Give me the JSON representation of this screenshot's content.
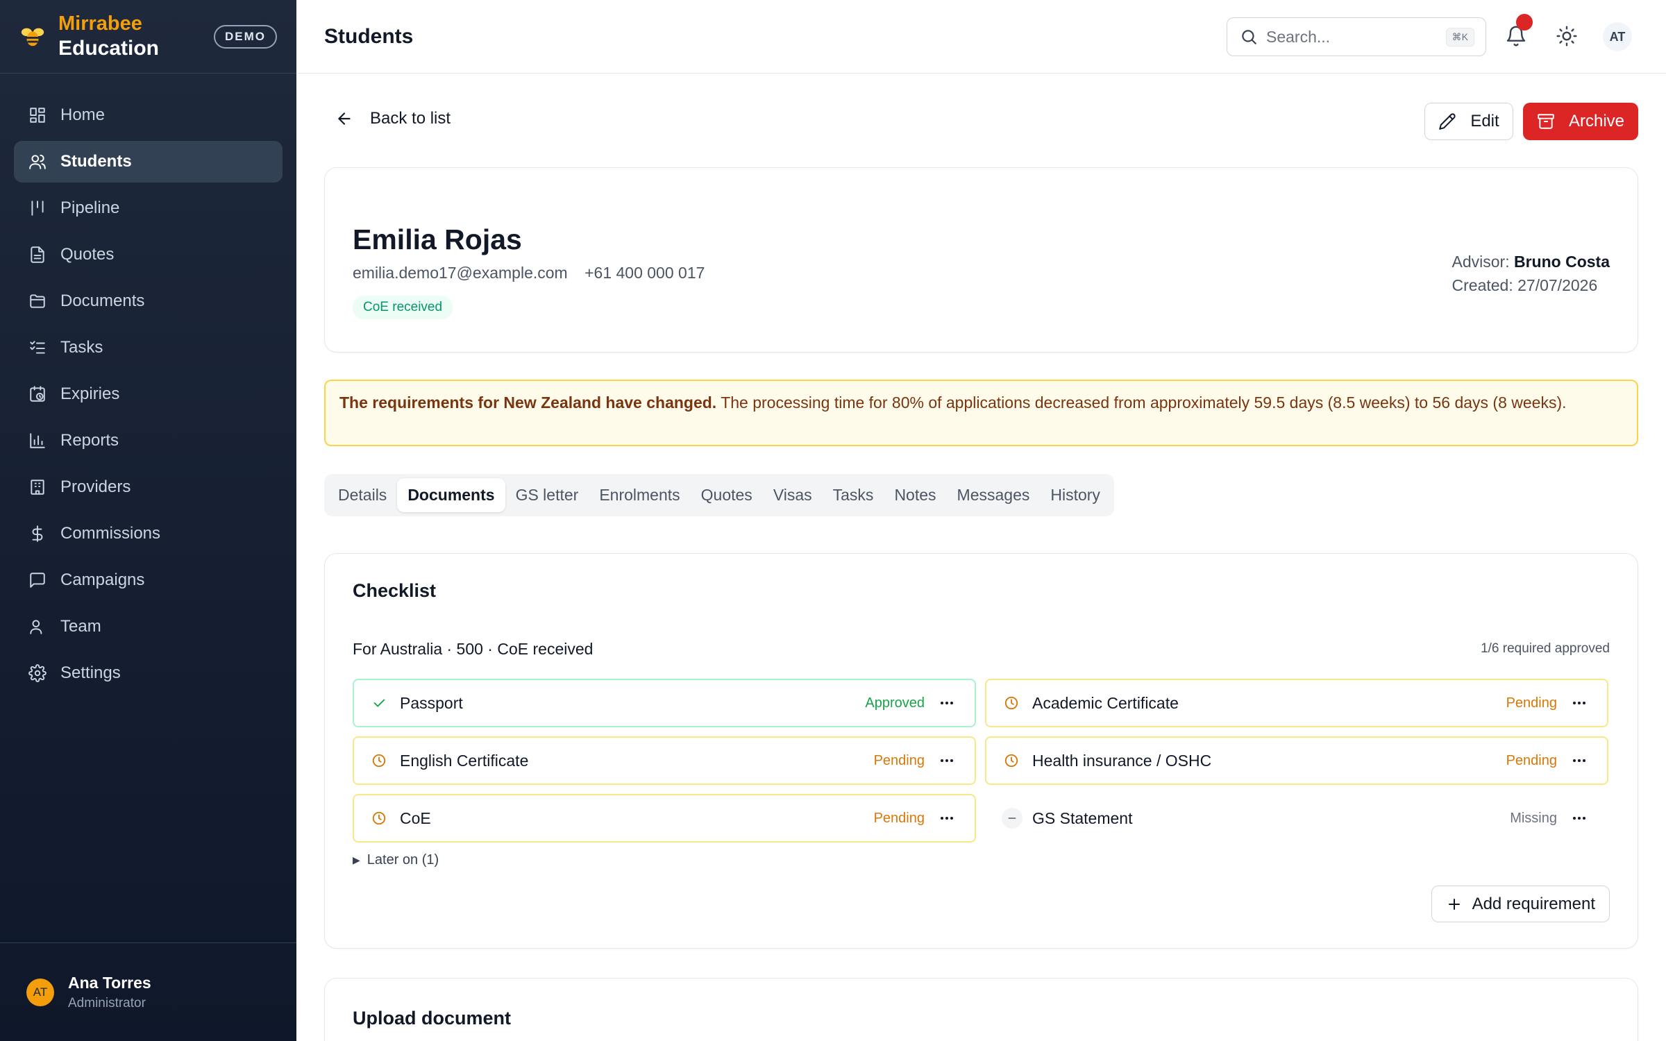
{
  "brand": {
    "name": "Mirrabee",
    "sub": "Education",
    "badge": "DEMO"
  },
  "sidebar": {
    "items": [
      {
        "label": "Home",
        "icon": "grid-icon",
        "active": false
      },
      {
        "label": "Students",
        "icon": "users-icon",
        "active": true
      },
      {
        "label": "Pipeline",
        "icon": "pipeline-icon",
        "active": false
      },
      {
        "label": "Quotes",
        "icon": "document-icon",
        "active": false
      },
      {
        "label": "Documents",
        "icon": "folder-icon",
        "active": false
      },
      {
        "label": "Tasks",
        "icon": "checklist-icon",
        "active": false
      },
      {
        "label": "Expiries",
        "icon": "calendar-clock-icon",
        "active": false
      },
      {
        "label": "Reports",
        "icon": "bar-chart-icon",
        "active": false
      },
      {
        "label": "Providers",
        "icon": "building-icon",
        "active": false
      },
      {
        "label": "Commissions",
        "icon": "dollar-icon",
        "active": false
      },
      {
        "label": "Campaigns",
        "icon": "message-icon",
        "active": false
      },
      {
        "label": "Team",
        "icon": "team-icon",
        "active": false
      },
      {
        "label": "Settings",
        "icon": "gear-icon",
        "active": false
      }
    ],
    "user": {
      "initials": "AT",
      "name": "Ana Torres",
      "role": "Administrator"
    }
  },
  "header": {
    "title": "Students",
    "search_placeholder": "Search...",
    "search_shortcut": "⌘K",
    "avatar_initials": "AT"
  },
  "actions": {
    "back": "Back to list",
    "edit": "Edit",
    "archive": "Archive"
  },
  "student": {
    "name": "Emilia Rojas",
    "email": "emilia.demo17@example.com",
    "phone": "+61 400 000 017",
    "status": "CoE received",
    "advisor_label": "Advisor:",
    "advisor": "Bruno Costa",
    "created_label": "Created:",
    "created": "27/07/2026"
  },
  "alert": {
    "title": "The requirements for New Zealand have changed.",
    "body": "The processing time for 80% of applications decreased from approximately 59.5 days (8.5 weeks) to 56 days (8 weeks)."
  },
  "tabs": [
    "Details",
    "Documents",
    "GS letter",
    "Enrolments",
    "Quotes",
    "Visas",
    "Tasks",
    "Notes",
    "Messages",
    "History"
  ],
  "active_tab": "Documents",
  "checklist": {
    "title": "Checklist",
    "subtitle": "For Australia · 500 · CoE received",
    "count": "1/6 required approved",
    "items": [
      {
        "name": "Passport",
        "status": "Approved",
        "state": "approved"
      },
      {
        "name": "Academic Certificate",
        "status": "Pending",
        "state": "pending"
      },
      {
        "name": "English Certificate",
        "status": "Pending",
        "state": "pending"
      },
      {
        "name": "Health insurance / OSHC",
        "status": "Pending",
        "state": "pending"
      },
      {
        "name": "CoE",
        "status": "Pending",
        "state": "pending"
      },
      {
        "name": "GS Statement",
        "status": "Missing",
        "state": "missing"
      }
    ],
    "later": "Later on (1)",
    "add_button": "Add requirement"
  },
  "upload": {
    "title": "Upload document"
  },
  "colors": {
    "brand": "#f59e0b",
    "sidebar_bg": "#1e293b",
    "danger": "#dc2626",
    "approved": "#16a34a",
    "pending": "#d97706",
    "alert_bg": "#fffbeb"
  }
}
